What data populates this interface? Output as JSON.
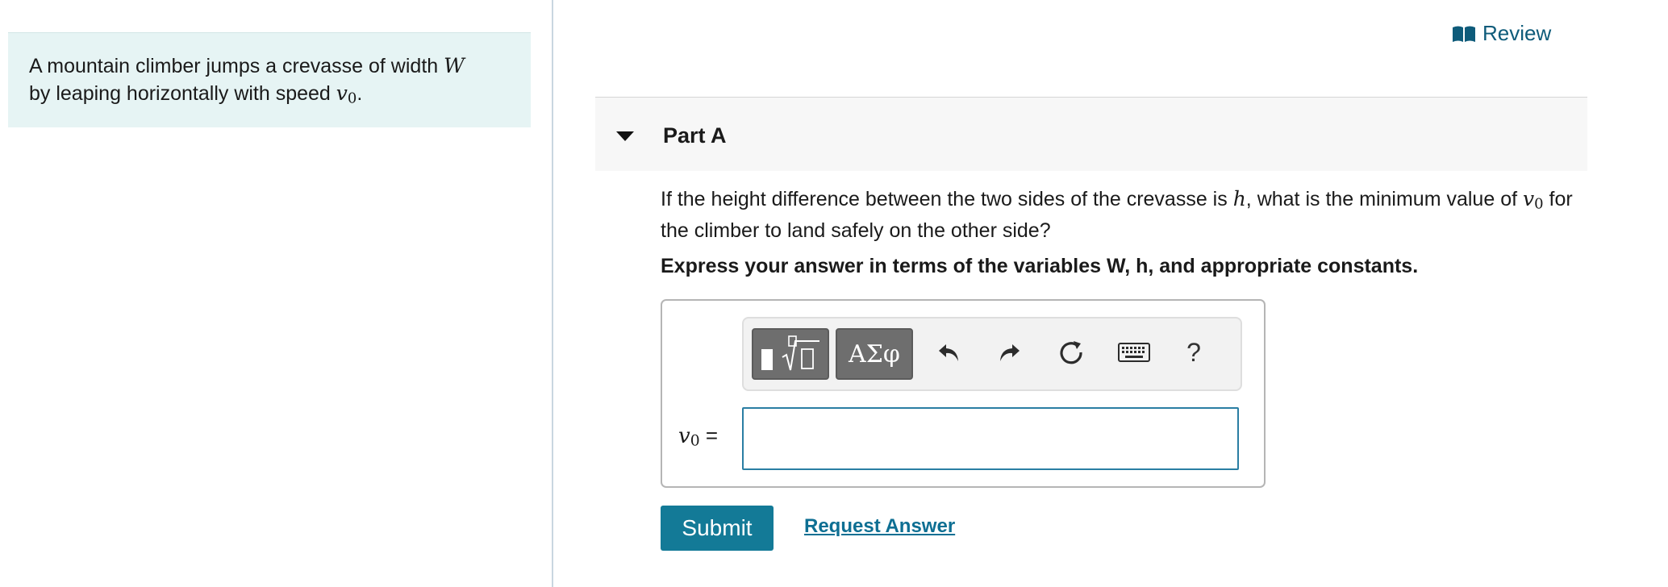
{
  "problem": {
    "line1_text": "A mountain climber jumps a crevasse of width ",
    "line1_var": "W",
    "line2_text": "by leaping horizontally with speed ",
    "speed_var": "v",
    "speed_sub": "0",
    "end": "."
  },
  "review": {
    "label": "Review",
    "icon": "book-icon"
  },
  "part": {
    "title": "Part A",
    "toggle_icon": "caret-down-icon",
    "question_pre": "If the height difference between the two sides of the crevasse is ",
    "question_var_h": "h",
    "question_mid": ", what is the minimum value of ",
    "question_var_v": "v",
    "question_var_v_sub": "0",
    "question_post": " for the climber to land safely on the other side?",
    "instruction": "Express your answer in terms of the variables W, h, and appropriate constants."
  },
  "toolbar": {
    "template_icon": "templates-icon",
    "greek_label": "ΑΣφ",
    "undo_icon": "undo-icon",
    "redo_icon": "redo-icon",
    "reset_icon": "reset-icon",
    "keyboard_icon": "keyboard-icon",
    "help_label": "?"
  },
  "answer": {
    "variable": "v",
    "variable_sub": "0",
    "equals": "=",
    "value": ""
  },
  "buttons": {
    "submit": "Submit",
    "request_answer": "Request Answer"
  },
  "colors": {
    "accent": "#137a97",
    "problem_bg": "#e6f4f4",
    "input_border": "#2a7ea3",
    "link": "#0e6f93"
  }
}
